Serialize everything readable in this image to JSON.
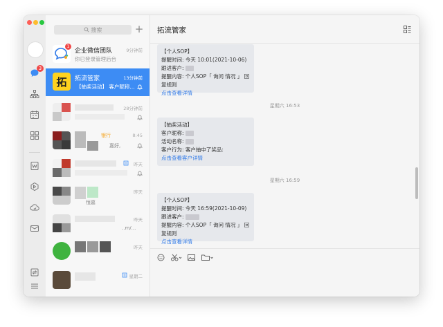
{
  "search": {
    "placeholder": "搜索"
  },
  "rail": {
    "badge": "3"
  },
  "conversations": [
    {
      "name": "企业微信团队",
      "sub": "你已登录管理后台",
      "time": "9分钟前",
      "badge": "1"
    },
    {
      "name": "拓流管家",
      "sub": "【抽奖活动】 客户昵称...",
      "time": "13分钟前",
      "avatar_text": "拓"
    },
    {
      "time": "28分钟前"
    },
    {
      "time": "8:45",
      "sub_a": "银行",
      "sub_b": "嘉好,"
    },
    {
      "time": "昨天"
    },
    {
      "time": "昨天",
      "sub": "恒嘉"
    },
    {
      "time": "昨天",
      "sub": "..m/..."
    },
    {
      "time": "昨天"
    },
    {
      "time": "星期二"
    }
  ],
  "chat": {
    "title": "拓流管家",
    "messages": [
      {
        "header": "【个人SOP】",
        "line1": "提醒时间: 今天 10:01(2021-10-06)",
        "line2": "跟进客户:",
        "line3": "提醒内容: 个人SOP「 询问      情况 」 回复规则",
        "link": "点击查看详情"
      },
      {
        "stamp": "星期六 16:53",
        "header": "【抽奖活动】",
        "line1": "客户昵称:",
        "line2": "活动名称:",
        "line3": "客户行为: 客户抽中了奖品:",
        "link": "点击查看客户详情"
      },
      {
        "stamp": "星期六 16:59",
        "header": "【个人SOP】",
        "line1": "提醒时间: 今天 16:59(2021-10-09)",
        "line2": "跟进客户:",
        "line3": "提醒内容: 个人SOP「 询问    情况 」 回复规则",
        "link": "点击查看详情"
      }
    ]
  },
  "colors": {
    "accent": "#3d8cf4",
    "link": "#2f79e8",
    "badge": "#f04848"
  }
}
